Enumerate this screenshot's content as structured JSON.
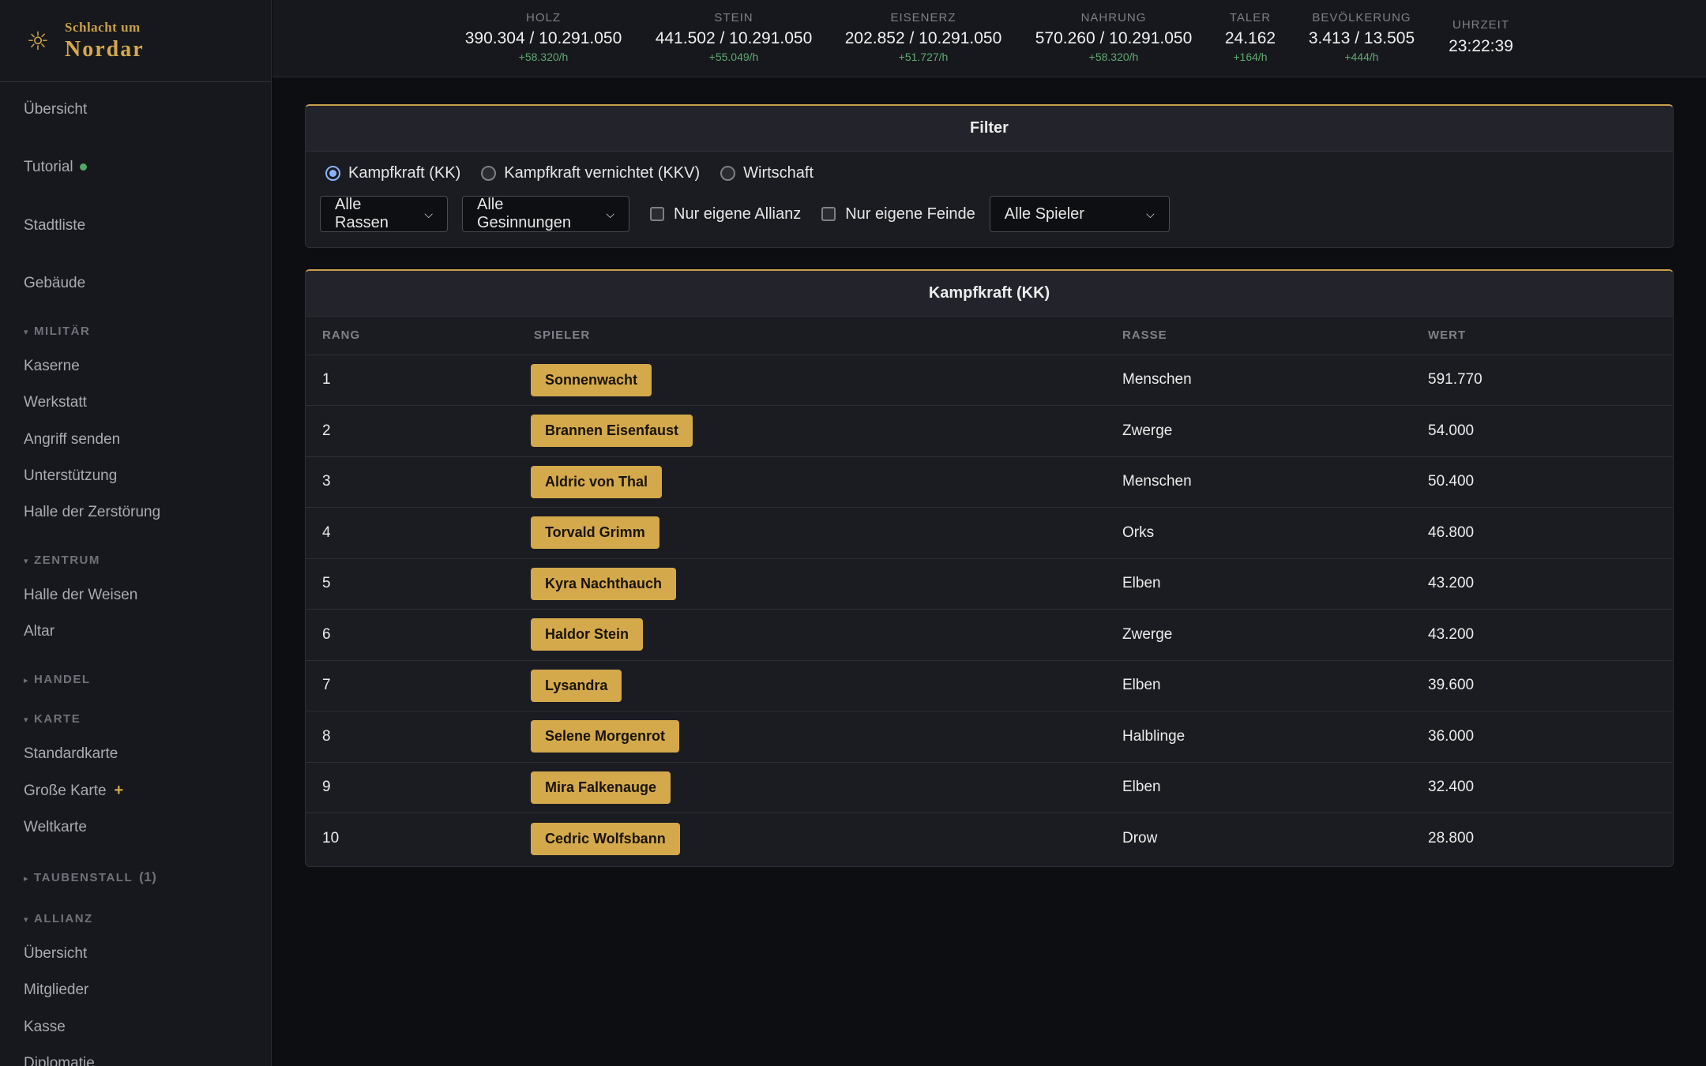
{
  "brand": {
    "icon": "sun-icon",
    "small": "Schlacht um",
    "big": "Nordar"
  },
  "sidebar": {
    "items": {
      "uebersicht": "Übersicht",
      "tutorial": "Tutorial",
      "stadtliste": "Stadtliste",
      "gebaeude": "Gebäude",
      "kaserne": "Kaserne",
      "werkstatt": "Werkstatt",
      "angriff": "Angriff senden",
      "unterstuetzung": "Unterstützung",
      "halle_zerstoerung": "Halle der Zerstörung",
      "halle_weisen": "Halle der Weisen",
      "altar": "Altar",
      "standardkarte": "Standardkarte",
      "grosse_karte": "Große Karte",
      "weltkarte": "Weltkarte",
      "allianz_uebersicht": "Übersicht",
      "mitglieder": "Mitglieder",
      "kasse": "Kasse",
      "diplomatie": "Diplomatie"
    },
    "sections": {
      "militaer": "MILITÄR",
      "zentrum": "ZENTRUM",
      "handel": "HANDEL",
      "karte": "KARTE",
      "taubenstall": "TAUBENSTALL",
      "taubenstall_count": "(1)",
      "allianz": "ALLIANZ"
    },
    "expanded_arrow": "▾",
    "collapsed_arrow": "▸",
    "plus": "+"
  },
  "resources": [
    {
      "label": "HOLZ",
      "value": "390.304 / 10.291.050",
      "rate": "+58.320/h"
    },
    {
      "label": "STEIN",
      "value": "441.502 / 10.291.050",
      "rate": "+55.049/h"
    },
    {
      "label": "EISENERZ",
      "value": "202.852 / 10.291.050",
      "rate": "+51.727/h"
    },
    {
      "label": "NAHRUNG",
      "value": "570.260 / 10.291.050",
      "rate": "+58.320/h"
    },
    {
      "label": "TALER",
      "value": "24.162",
      "rate": "+164/h"
    },
    {
      "label": "BEVÖLKERUNG",
      "value": "3.413 / 13.505",
      "rate": "+444/h"
    }
  ],
  "clock": {
    "label": "UHRZEIT",
    "value": "23:22:39"
  },
  "filter": {
    "title": "Filter",
    "radios": [
      "Kampfkraft (KK)",
      "Kampfkraft vernichtet (KKV)",
      "Wirtschaft"
    ],
    "selected_radio": 0,
    "race_select": "Alle Rassen",
    "alignment_select": "Alle Gesinnungen",
    "own_alliance": "Nur eigene Allianz",
    "own_enemies": "Nur eigene Feinde",
    "player_select": "Alle Spieler"
  },
  "ranking": {
    "title": "Kampfkraft (KK)",
    "columns": [
      "RANG",
      "SPIELER",
      "RASSE",
      "WERT"
    ],
    "rows": [
      {
        "rank": "1",
        "player": "Sonnenwacht",
        "race": "Menschen",
        "value": "591.770"
      },
      {
        "rank": "2",
        "player": "Brannen Eisenfaust",
        "race": "Zwerge",
        "value": "54.000"
      },
      {
        "rank": "3",
        "player": "Aldric von Thal",
        "race": "Menschen",
        "value": "50.400"
      },
      {
        "rank": "4",
        "player": "Torvald Grimm",
        "race": "Orks",
        "value": "46.800"
      },
      {
        "rank": "5",
        "player": "Kyra Nachthauch",
        "race": "Elben",
        "value": "43.200"
      },
      {
        "rank": "6",
        "player": "Haldor Stein",
        "race": "Zwerge",
        "value": "43.200"
      },
      {
        "rank": "7",
        "player": "Lysandra",
        "race": "Elben",
        "value": "39.600"
      },
      {
        "rank": "8",
        "player": "Selene Morgenrot",
        "race": "Halblinge",
        "value": "36.000"
      },
      {
        "rank": "9",
        "player": "Mira Falkenauge",
        "race": "Elben",
        "value": "32.400"
      },
      {
        "rank": "10",
        "player": "Cedric Wolfsbann",
        "race": "Drow",
        "value": "28.800"
      }
    ]
  },
  "colors": {
    "accent": "#d4a94c",
    "positive": "#5fa96f",
    "background": "#0d0e12",
    "panel": "#1b1c21"
  }
}
